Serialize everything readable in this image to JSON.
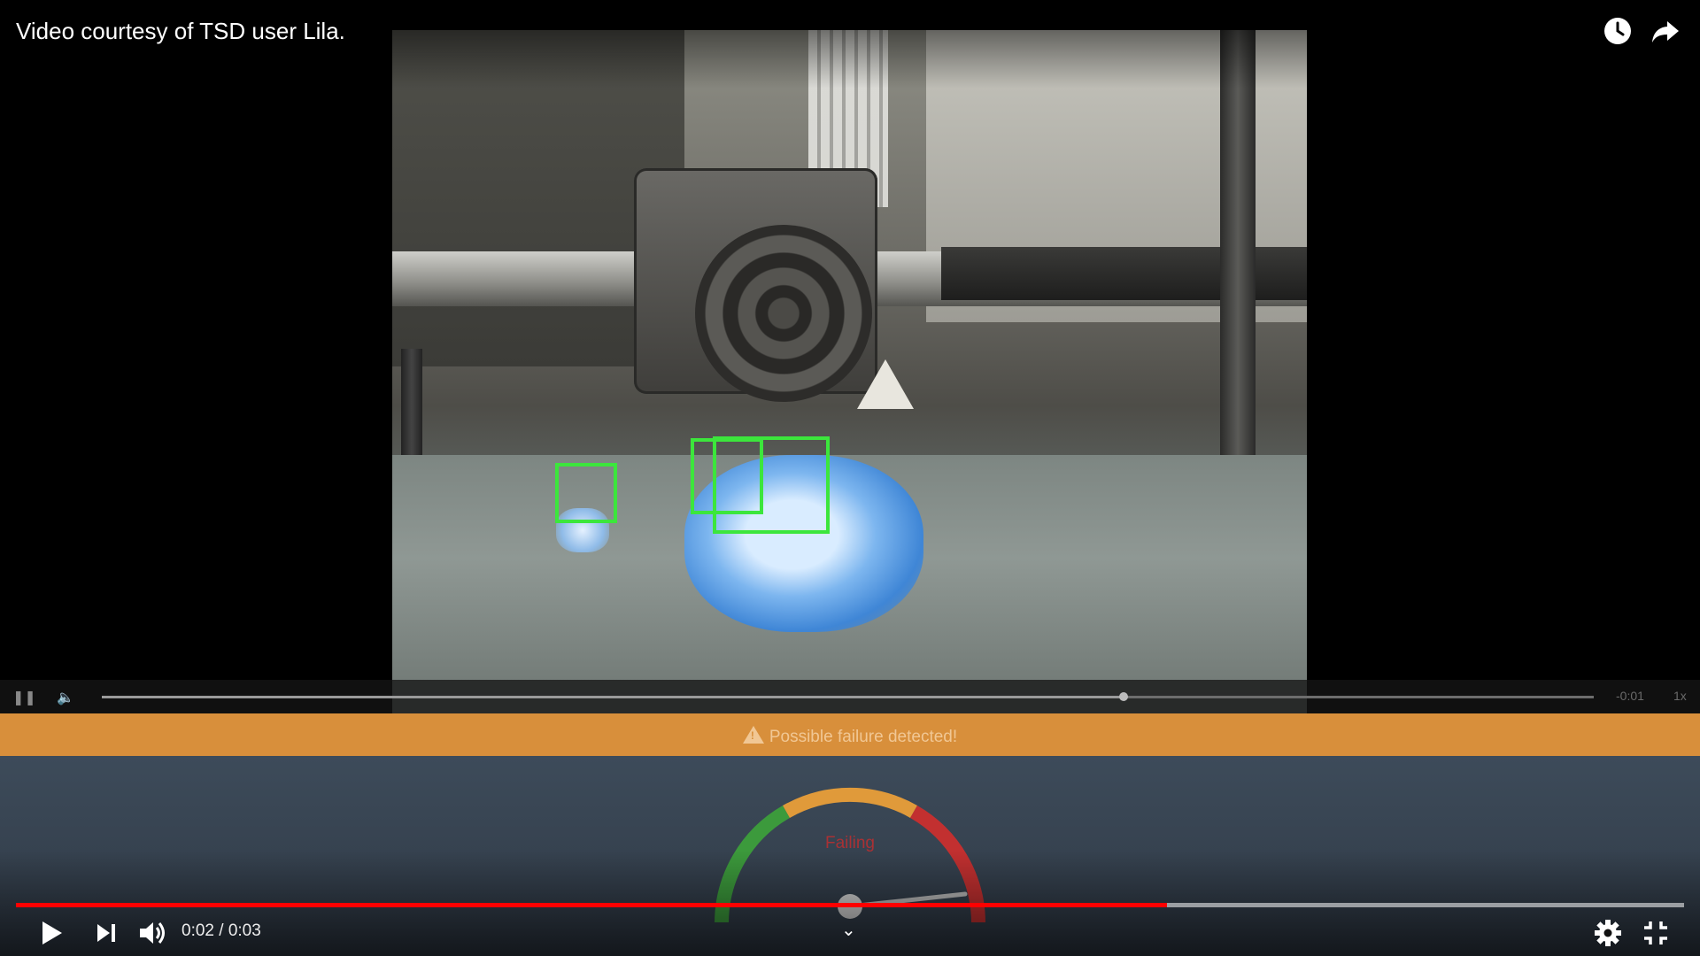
{
  "video": {
    "title": "Video courtesy of TSD user Lila.",
    "current_time": "0:02",
    "duration": "0:03",
    "separator": "/",
    "progress_fraction": 0.69,
    "accent_color": "#ff0000"
  },
  "embedded_video": {
    "alert_text": "Possible failure detected!",
    "alert_color": "#d88f3b",
    "gauge_label": "Failing",
    "inner_time": "-0:01",
    "inner_speed": "1x",
    "inner_progress_fraction": 0.685,
    "detection_box_color": "#3ce63c"
  },
  "icons": {
    "watch_later": "clock-icon",
    "share": "share-icon",
    "play": "play-icon",
    "next": "skip-next-icon",
    "volume": "volume-icon",
    "settings": "gear-icon",
    "exit_fullscreen": "exit-fullscreen-icon",
    "chevron": "chevron-down-icon"
  }
}
